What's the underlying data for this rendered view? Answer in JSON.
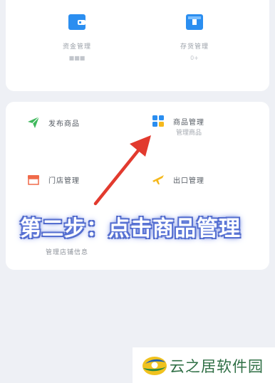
{
  "top_card": {
    "items": [
      {
        "label": "资金管理",
        "sub": "■■■",
        "icon": "wallet-icon",
        "color": "#2b8ef0"
      },
      {
        "label": "存货管理",
        "sub": "0+",
        "icon": "box-icon",
        "color": "#2b8ef0"
      }
    ]
  },
  "mid_card": {
    "items": [
      {
        "label": "发布商品",
        "sub": "",
        "icon": "paper-plane-icon",
        "color": "#3fb85c"
      },
      {
        "label": "商品管理",
        "sub": "管理商品",
        "icon": "grid-icon",
        "color": "#2b8ef0"
      },
      {
        "label": "门店管理",
        "sub": "",
        "icon": "store-icon",
        "color": "#f06a4a"
      },
      {
        "label": "出口管理",
        "sub": "",
        "icon": "airplane-icon",
        "color": "#f5b81c"
      }
    ],
    "bottom_sub": "管理店铺信息"
  },
  "overlay": {
    "caption": "第二步：点击商品管理",
    "arrow_color": "#e23a2e",
    "caption_glow": "#5b76d6"
  },
  "watermark": {
    "text": "云之居软件园",
    "text_color": "#2f6f45"
  }
}
